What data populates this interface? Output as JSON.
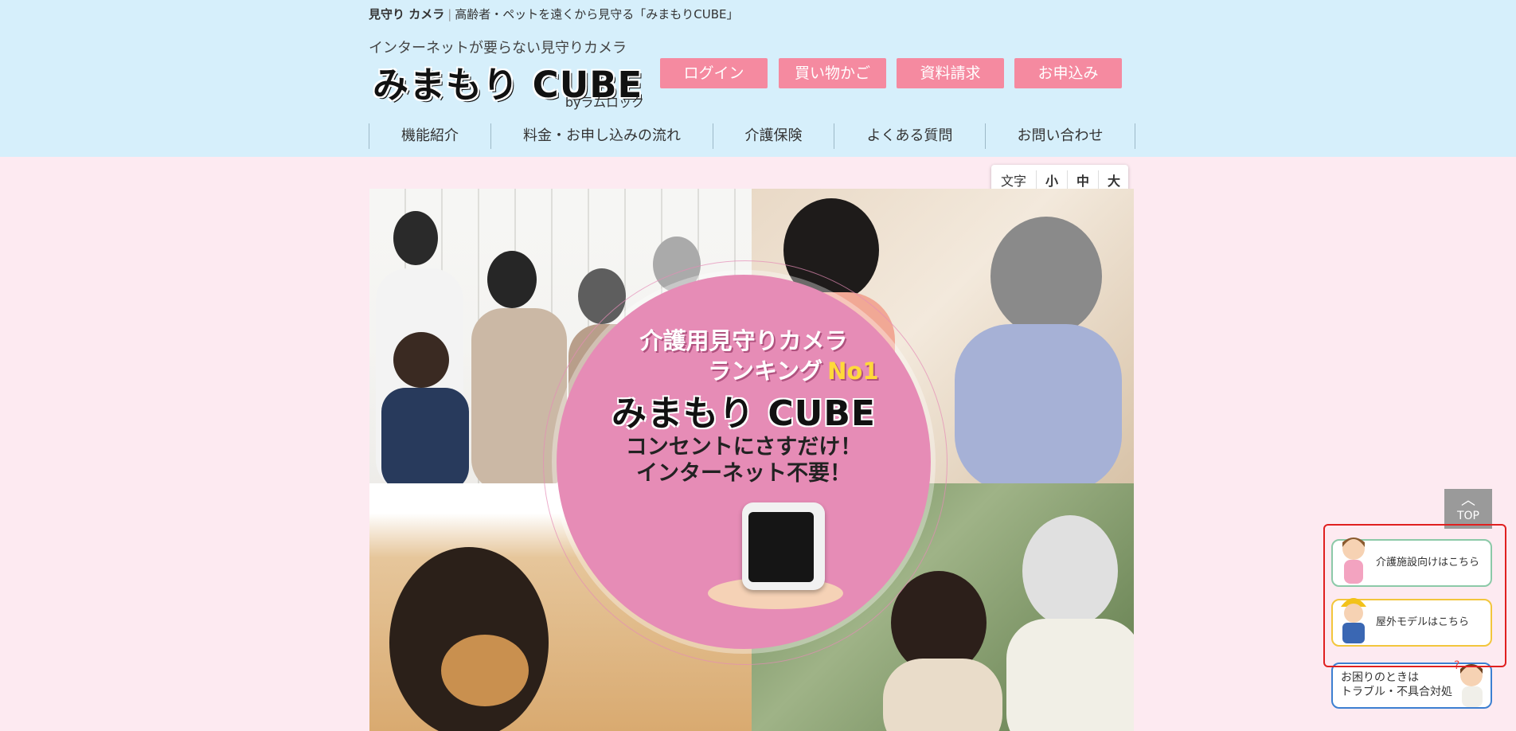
{
  "header": {
    "tagline_strong": "見守り カメラ",
    "tagline_rest": "高齢者・ペットを遠くから見守る「みまもりCUBE」",
    "subcopy": "インターネットが要らない見守りカメラ",
    "logo_main": "みまもり CUBE",
    "logo_by": "byラムロック",
    "buttons": [
      "ログイン",
      "買い物かご",
      "資料請求",
      "お申込み"
    ],
    "nav": [
      "機能紹介",
      "料金・お申し込みの流れ",
      "介護保険",
      "よくある質問",
      "お問い合わせ"
    ]
  },
  "font_size_switcher": {
    "label": "文字",
    "options": [
      "小",
      "中",
      "大"
    ]
  },
  "hero": {
    "badge_line1": "介護用見守りカメラ",
    "badge_line2": "ランキング",
    "badge_no1": "No1",
    "badge_logo": "みまもり CUBE",
    "badge_line4a": "コンセントにさすだけ！",
    "badge_line4b": "インターネット不要！"
  },
  "side": {
    "top_label": "TOP",
    "care_facility": "介護施設向けはこちら",
    "outdoor_model": "屋外モデルはこちら",
    "trouble_line1": "お困りのときは",
    "trouble_line2": "トラブル・不具合対処"
  },
  "colors": {
    "header_bg": "#d6effb",
    "page_bg": "#fdeaf1",
    "button_pink": "#f58aa0",
    "badge_pink": "#e68cb6",
    "annotation_red": "#e02020"
  }
}
